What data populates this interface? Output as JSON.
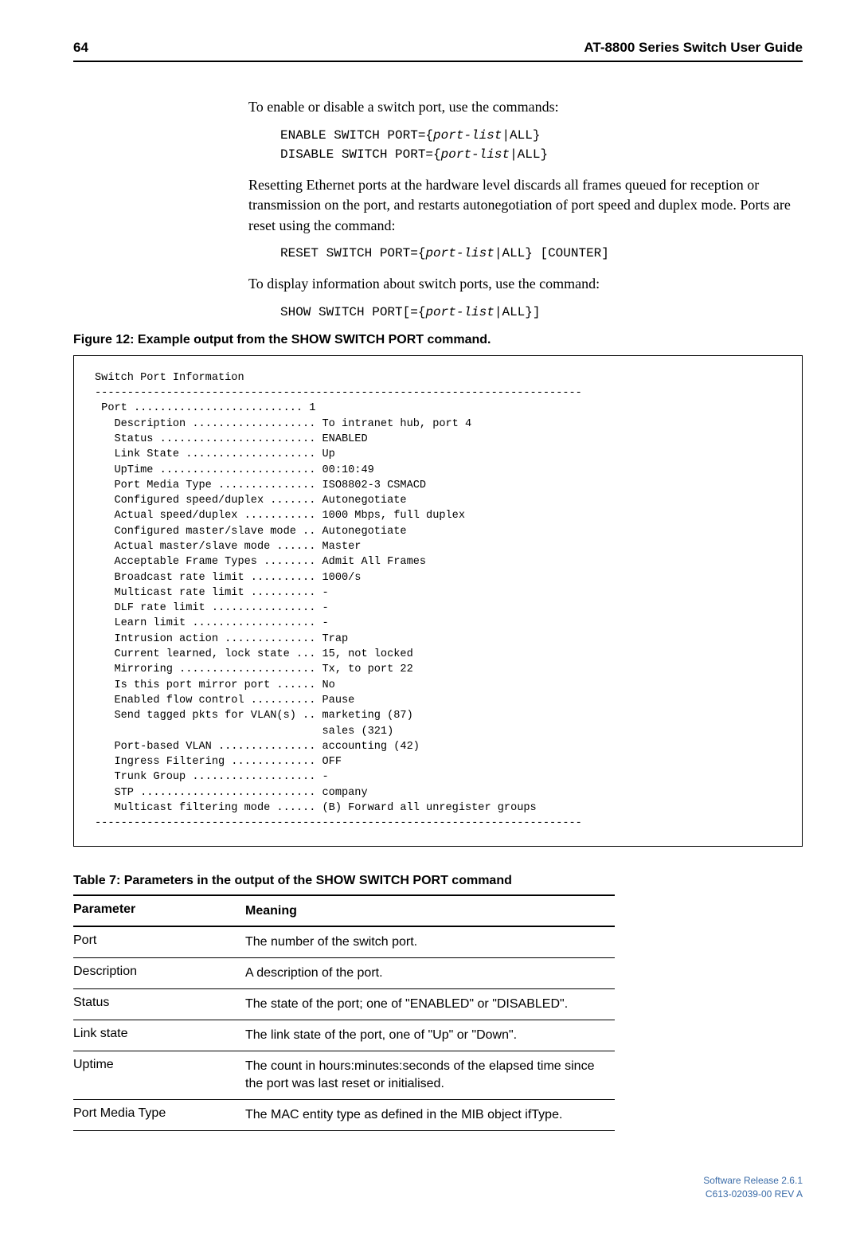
{
  "header": {
    "page_num": "64",
    "guide_title": "AT-8800 Series Switch User Guide"
  },
  "body": {
    "p1": "To enable or disable a switch port, use the commands:",
    "code1_prefix": "ENABLE SWITCH PORT={",
    "code1_var": "port-list",
    "code1_suffix": "|ALL}",
    "code2_prefix": "DISABLE SWITCH PORT={",
    "code2_var": "port-list",
    "code2_suffix": "|ALL}",
    "p2": "Resetting Ethernet ports at the hardware level discards all frames queued for reception or transmission on the port, and restarts autonegotiation of port speed and duplex mode. Ports are reset using the command:",
    "code3_prefix": "RESET SWITCH PORT={",
    "code3_var": "port-list",
    "code3_suffix": "|ALL} [COUNTER]",
    "p3": "To display information about switch ports, use the command:",
    "code4_prefix": "SHOW SWITCH PORT[={",
    "code4_var": "port-list",
    "code4_suffix": "|ALL}]"
  },
  "figure": {
    "caption": "Figure 12: Example output from the SHOW SWITCH PORT command.",
    "terminal": "Switch Port Information\n---------------------------------------------------------------------------\n Port .......................... 1\n   Description ................... To intranet hub, port 4\n   Status ........................ ENABLED\n   Link State .................... Up\n   UpTime ........................ 00:10:49\n   Port Media Type ............... ISO8802-3 CSMACD\n   Configured speed/duplex ....... Autonegotiate\n   Actual speed/duplex ........... 1000 Mbps, full duplex\n   Configured master/slave mode .. Autonegotiate\n   Actual master/slave mode ...... Master\n   Acceptable Frame Types ........ Admit All Frames\n   Broadcast rate limit .......... 1000/s\n   Multicast rate limit .......... -\n   DLF rate limit ................ -\n   Learn limit ................... -\n   Intrusion action .............. Trap\n   Current learned, lock state ... 15, not locked\n   Mirroring ..................... Tx, to port 22\n   Is this port mirror port ...... No\n   Enabled flow control .......... Pause\n   Send tagged pkts for VLAN(s) .. marketing (87)\n                                   sales (321)\n   Port-based VLAN ............... accounting (42)\n   Ingress Filtering ............. OFF\n   Trunk Group ................... -\n   STP ........................... company\n   Multicast filtering mode ...... (B) Forward all unregister groups\n---------------------------------------------------------------------------"
  },
  "table": {
    "caption": "Table 7: Parameters in the output of the SHOW SWITCH PORT command",
    "header": {
      "c1": "Parameter",
      "c2": "Meaning"
    },
    "rows": [
      {
        "c1": "Port",
        "c2": "The number of the switch port."
      },
      {
        "c1": "Description",
        "c2": "A description of the port."
      },
      {
        "c1": "Status",
        "c2": "The state of the port; one of \"ENABLED\" or \"DISABLED\"."
      },
      {
        "c1": "Link state",
        "c2": "The link state of the port, one of \"Up\" or \"Down\"."
      },
      {
        "c1": "Uptime",
        "c2": "The count in hours:minutes:seconds of the elapsed time since the port was last reset or initialised."
      },
      {
        "c1": "Port Media Type",
        "c2": "The MAC entity type as defined in the MIB object ifType."
      }
    ]
  },
  "footer": {
    "line1": "Software Release 2.6.1",
    "line2": "C613-02039-00 REV A"
  }
}
